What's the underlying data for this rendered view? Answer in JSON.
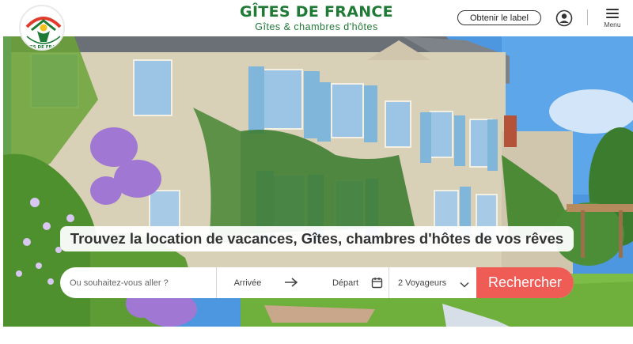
{
  "header": {
    "brand_title": "GÎTES DE FRANCE",
    "brand_subtitle": "Gîtes & chambres d'hôtes",
    "label_button": "Obtenir le label",
    "menu_label": "Menu",
    "logo_text": "GÎTES DE FRANCE"
  },
  "hero": {
    "headline": "Trouvez la location de vacances, Gîtes, chambres d'hôtes de vos rêves"
  },
  "search": {
    "destination_placeholder": "Ou souhaitez-vous aller ?",
    "arrival_label": "Arrivée",
    "departure_label": "Départ",
    "travelers_value": "2 Voyageurs",
    "submit_label": "Rechercher"
  },
  "colors": {
    "brand_green": "#1f7a35",
    "accent_red": "#ef5b55"
  },
  "icons": [
    "logo-icon",
    "user-icon",
    "menu-icon",
    "arrow-right-icon",
    "calendar-icon",
    "chevron-down-icon"
  ]
}
